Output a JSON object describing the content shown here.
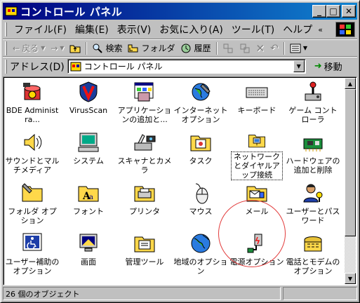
{
  "window": {
    "title": "コントロール パネル",
    "buttons": {
      "minimize": "_",
      "maximize": "□",
      "close": "✕"
    }
  },
  "menu": {
    "items": [
      "ファイル(F)",
      "編集(E)",
      "表示(V)",
      "お気に入り(A)",
      "ツール(T)",
      "ヘルプ"
    ],
    "overflow": "«"
  },
  "toolbar": {
    "back": "戻る",
    "search": "検索",
    "folders": "フォルダ",
    "history": "履歴"
  },
  "address": {
    "label": "アドレス(D)",
    "value": "コントロール パネル",
    "go": "移動"
  },
  "items": [
    {
      "label": "BDE Administra...",
      "icon": "bde-admin-icon"
    },
    {
      "label": "VirusScan",
      "icon": "virusscan-icon"
    },
    {
      "label": "アプリケーションの追加と...",
      "icon": "add-remove-programs-icon"
    },
    {
      "label": "インターネット オプション",
      "icon": "internet-options-icon"
    },
    {
      "label": "キーボード",
      "icon": "keyboard-icon"
    },
    {
      "label": "ゲーム コントローラ",
      "icon": "game-controllers-icon"
    },
    {
      "label": "サウンドとマルチメディア",
      "icon": "sounds-multimedia-icon"
    },
    {
      "label": "システム",
      "icon": "system-icon"
    },
    {
      "label": "スキャナとカメラ",
      "icon": "scanners-cameras-icon"
    },
    {
      "label": "タスク",
      "icon": "scheduled-tasks-icon"
    },
    {
      "label": "ネットワークとダイヤルアップ接続",
      "icon": "network-dialup-icon"
    },
    {
      "label": "ハードウェアの追加と削除",
      "icon": "add-remove-hardware-icon"
    },
    {
      "label": "フォルダ オプション",
      "icon": "folder-options-icon"
    },
    {
      "label": "フォント",
      "icon": "fonts-icon"
    },
    {
      "label": "プリンタ",
      "icon": "printers-icon"
    },
    {
      "label": "マウス",
      "icon": "mouse-icon"
    },
    {
      "label": "メール",
      "icon": "mail-icon"
    },
    {
      "label": "ユーザーとパスワード",
      "icon": "users-passwords-icon"
    },
    {
      "label": "ユーザー補助のオプション",
      "icon": "accessibility-icon"
    },
    {
      "label": "画面",
      "icon": "display-icon"
    },
    {
      "label": "管理ツール",
      "icon": "admin-tools-icon"
    },
    {
      "label": "地域のオプション",
      "icon": "regional-options-icon"
    },
    {
      "label": "電源オプション",
      "icon": "power-options-icon"
    },
    {
      "label": "電話とモデムのオプション",
      "icon": "phone-modem-icon"
    }
  ],
  "status": {
    "text": "26 個のオブジェクト"
  },
  "colors": {
    "title_start": "#000080",
    "title_end": "#1084d0",
    "face": "#c0c0c0",
    "highlight_circle": "#e23b3b"
  }
}
